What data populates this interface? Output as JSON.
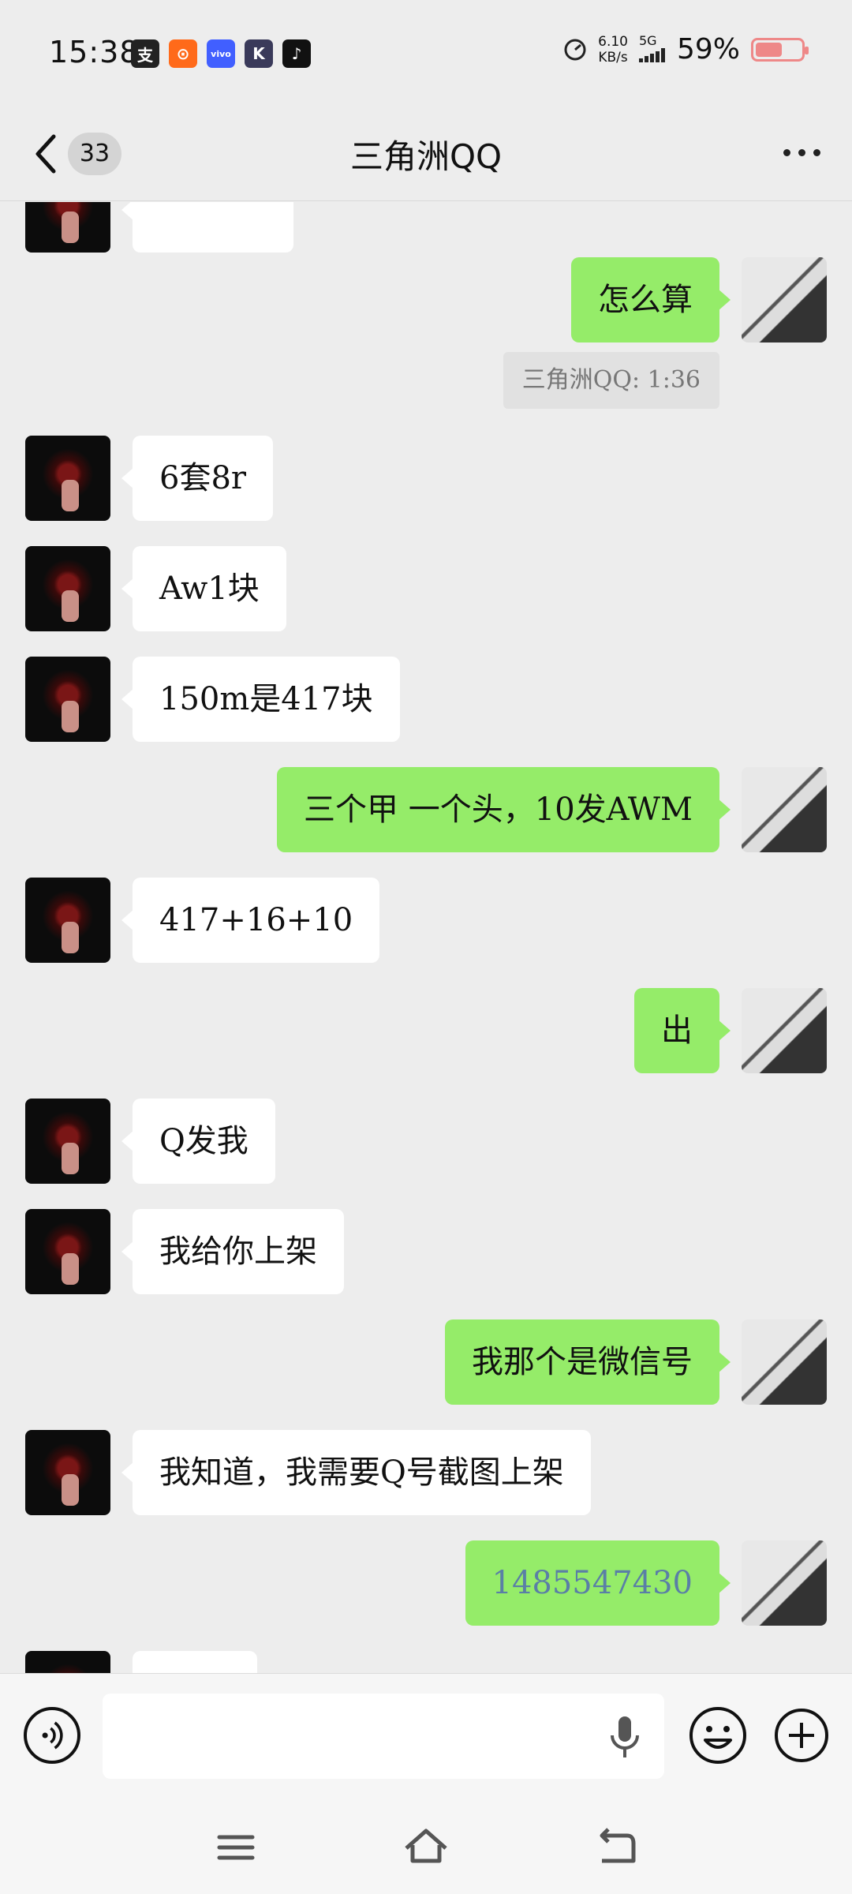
{
  "status_bar": {
    "time": "15:38",
    "apps": [
      {
        "icon": "alipay-icon",
        "glyph": "支",
        "color": "#222222"
      },
      {
        "icon": "kuaishou-icon",
        "glyph": "⊙",
        "color": "#ff6a1a"
      },
      {
        "icon": "vivo-icon",
        "glyph": "vivo",
        "color": "#415fff"
      },
      {
        "icon": "k-app-icon",
        "glyph": "K",
        "color": "#3a3a5a"
      },
      {
        "icon": "tiktok-icon",
        "glyph": "♪",
        "color": "#111111"
      }
    ],
    "net_speed": "6.10",
    "net_unit": "KB/s",
    "network": "5G",
    "battery_pct": "59%",
    "battery_level": 0.59
  },
  "header": {
    "unread_count": "33",
    "title": "三角洲QQ"
  },
  "messages": [
    {
      "side": "right",
      "text": "怎么算"
    },
    {
      "type": "quote",
      "text": "三角洲QQ: 1:36"
    },
    {
      "side": "left",
      "text": "6套8r"
    },
    {
      "side": "left",
      "text": "Aw1块"
    },
    {
      "side": "left",
      "text": "150m是417块"
    },
    {
      "side": "right",
      "text": "三个甲 一个头，10发AWM"
    },
    {
      "side": "left",
      "text": "417+16+10"
    },
    {
      "side": "right",
      "text": "出"
    },
    {
      "side": "left",
      "text": "Q发我"
    },
    {
      "side": "left",
      "text": "我给你上架"
    },
    {
      "side": "right",
      "text": "我那个是微信号"
    },
    {
      "side": "left",
      "text": "我知道，我需要Q号截图上架"
    },
    {
      "side": "right",
      "text": "1485547430",
      "link": true
    }
  ],
  "colors": {
    "background": "#ededed",
    "bubble_self": "#95ec69",
    "bubble_other": "#ffffff"
  }
}
